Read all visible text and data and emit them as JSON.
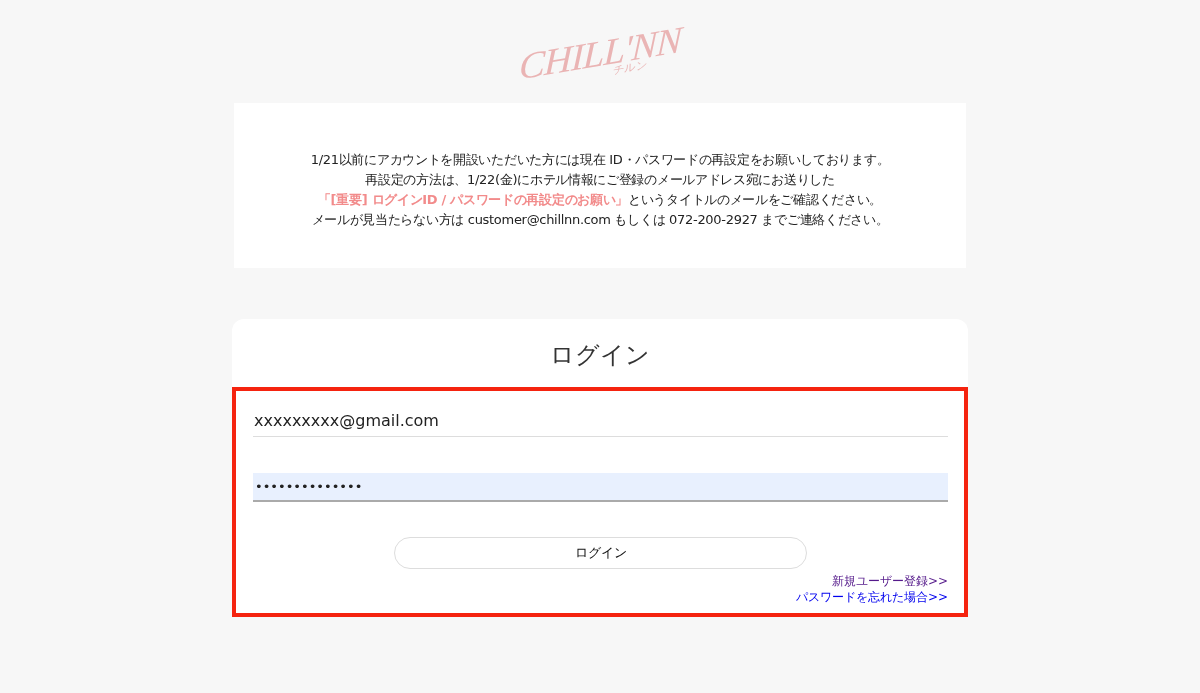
{
  "logo": {
    "wordmark": "CHILL'NN",
    "subtitle": "チルン"
  },
  "notice": {
    "lines": [
      "1/21以前にアカウントを開設いただいた方には現在 ID・パスワードの再設定をお願いしております。",
      "再設定の方法は、1/22(金)にホテル情報にご登録のメールアドレス宛にお送りした",
      "**「[重要] ログインID / パスワードの再設定のお願い」**というタイトルのメールをご確認ください。",
      "メールが見当たらない方は customer@chillnn.com もしくは 072-200-2927 までご連絡ください。"
    ]
  },
  "login": {
    "title": "ログイン",
    "highlighted": true,
    "email": {
      "value": "xxxxxxxxx@gmail.com",
      "autofilled": false
    },
    "password": {
      "value": "••••••••••••••",
      "autofilled": true
    },
    "button": "ログイン",
    "links": [
      {
        "label": "新規ユーザー登録>>",
        "visited": true
      },
      {
        "label": "パスワードを忘れた場合>>",
        "visited": false
      }
    ]
  }
}
